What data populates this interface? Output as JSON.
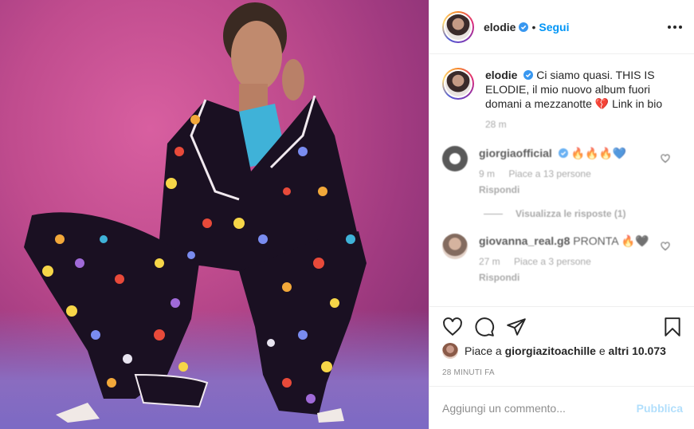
{
  "post": {
    "username": "elodie",
    "follow_label": "Segui",
    "dot": "•"
  },
  "caption": {
    "username": "elodie",
    "text": "Ci siamo quasi. THIS IS ELODIE, il mio nuovo album fuori domani a mezzanotte 💔 Link in bio",
    "time": "28 m"
  },
  "comments": [
    {
      "username": "giorgiaofficial",
      "text": "🔥🔥🔥💙",
      "time": "9 m",
      "likes": "Piace a 13 persone",
      "reply": "Rispondi",
      "view_replies": "Visualizza le risposte (1)"
    },
    {
      "username": "giovanna_real.g8",
      "text": "PRONTA 🔥🖤",
      "time": "27 m",
      "likes": "Piace a 3 persone",
      "reply": "Rispondi"
    }
  ],
  "likes": {
    "prefix": "Piace a",
    "user": "giorgiazitoachille",
    "connector": "e",
    "others": "altri 10.073"
  },
  "timestamp": "28 MINUTI FA",
  "add_comment": {
    "placeholder": "Aggiungi un commento...",
    "publish_label": "Pubblica"
  },
  "colors": {
    "accent": "#0095f6",
    "verified": "#3897f0",
    "publish_disabled": "#b2dffc"
  }
}
